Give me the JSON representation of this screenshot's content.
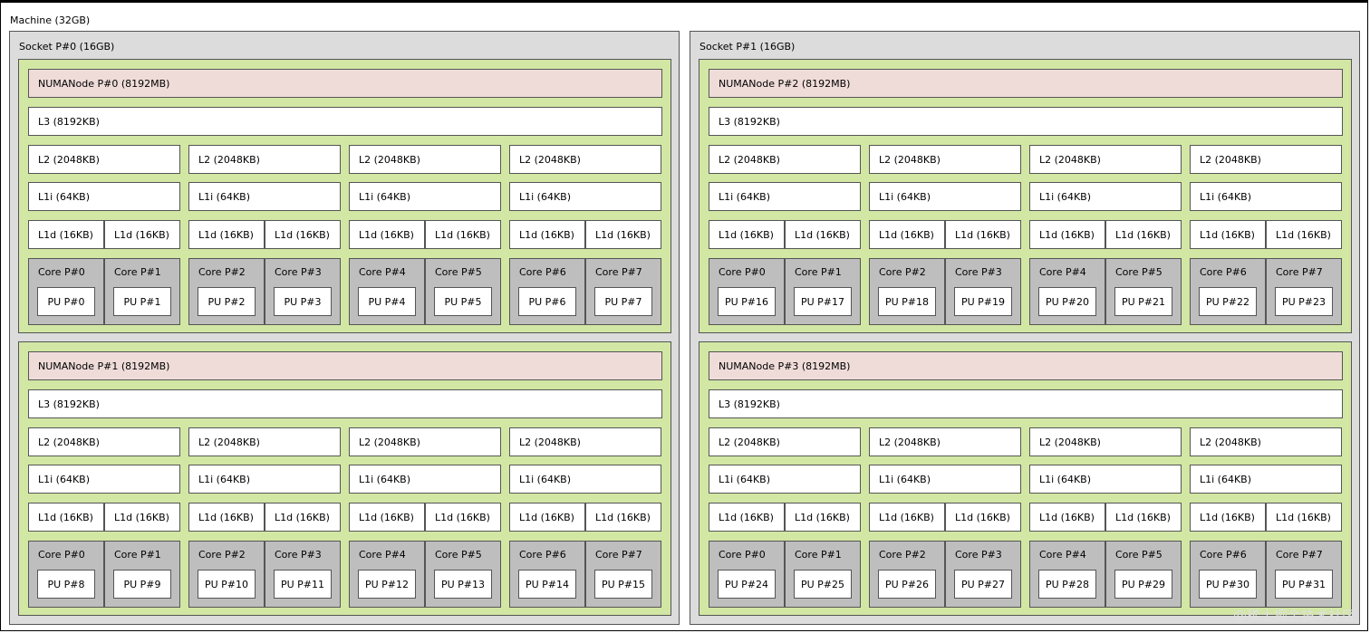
{
  "machine": {
    "label": "Machine (32GB)"
  },
  "sockets": [
    {
      "label": "Socket P#0 (16GB)",
      "numa": [
        {
          "label": "NUMANode P#0 (8192MB)",
          "l3": "L3 (8192KB)",
          "l2": "L2 (2048KB)",
          "l1i": "L1i (64KB)",
          "l1d": "L1d (16KB)",
          "cores": [
            "Core P#0",
            "Core P#1",
            "Core P#2",
            "Core P#3",
            "Core P#4",
            "Core P#5",
            "Core P#6",
            "Core P#7"
          ],
          "pus": [
            "PU P#0",
            "PU P#1",
            "PU P#2",
            "PU P#3",
            "PU P#4",
            "PU P#5",
            "PU P#6",
            "PU P#7"
          ]
        },
        {
          "label": "NUMANode P#1 (8192MB)",
          "l3": "L3 (8192KB)",
          "l2": "L2 (2048KB)",
          "l1i": "L1i (64KB)",
          "l1d": "L1d (16KB)",
          "cores": [
            "Core P#0",
            "Core P#1",
            "Core P#2",
            "Core P#3",
            "Core P#4",
            "Core P#5",
            "Core P#6",
            "Core P#7"
          ],
          "pus": [
            "PU P#8",
            "PU P#9",
            "PU P#10",
            "PU P#11",
            "PU P#12",
            "PU P#13",
            "PU P#14",
            "PU P#15"
          ]
        }
      ]
    },
    {
      "label": "Socket P#1 (16GB)",
      "numa": [
        {
          "label": "NUMANode P#2 (8192MB)",
          "l3": "L3 (8192KB)",
          "l2": "L2 (2048KB)",
          "l1i": "L1i (64KB)",
          "l1d": "L1d (16KB)",
          "cores": [
            "Core P#0",
            "Core P#1",
            "Core P#2",
            "Core P#3",
            "Core P#4",
            "Core P#5",
            "Core P#6",
            "Core P#7"
          ],
          "pus": [
            "PU P#16",
            "PU P#17",
            "PU P#18",
            "PU P#19",
            "PU P#20",
            "PU P#21",
            "PU P#22",
            "PU P#23"
          ]
        },
        {
          "label": "NUMANode P#3 (8192MB)",
          "l3": "L3 (8192KB)",
          "l2": "L2 (2048KB)",
          "l1i": "L1i (64KB)",
          "l1d": "L1d (16KB)",
          "cores": [
            "Core P#0",
            "Core P#1",
            "Core P#2",
            "Core P#3",
            "Core P#4",
            "Core P#5",
            "Core P#6",
            "Core P#7"
          ],
          "pus": [
            "PU P#24",
            "PU P#25",
            "PU P#26",
            "PU P#27",
            "PU P#28",
            "PU P#29",
            "PU P#30",
            "PU P#31"
          ]
        }
      ]
    }
  ],
  "watermark": "@稀土掘金技术社区",
  "colors": {
    "socket": "#dcdcdc",
    "numa": "#d2e7a4",
    "numa_label": "#efdcd9",
    "core": "#bebebe",
    "cache": "#ffffff"
  }
}
